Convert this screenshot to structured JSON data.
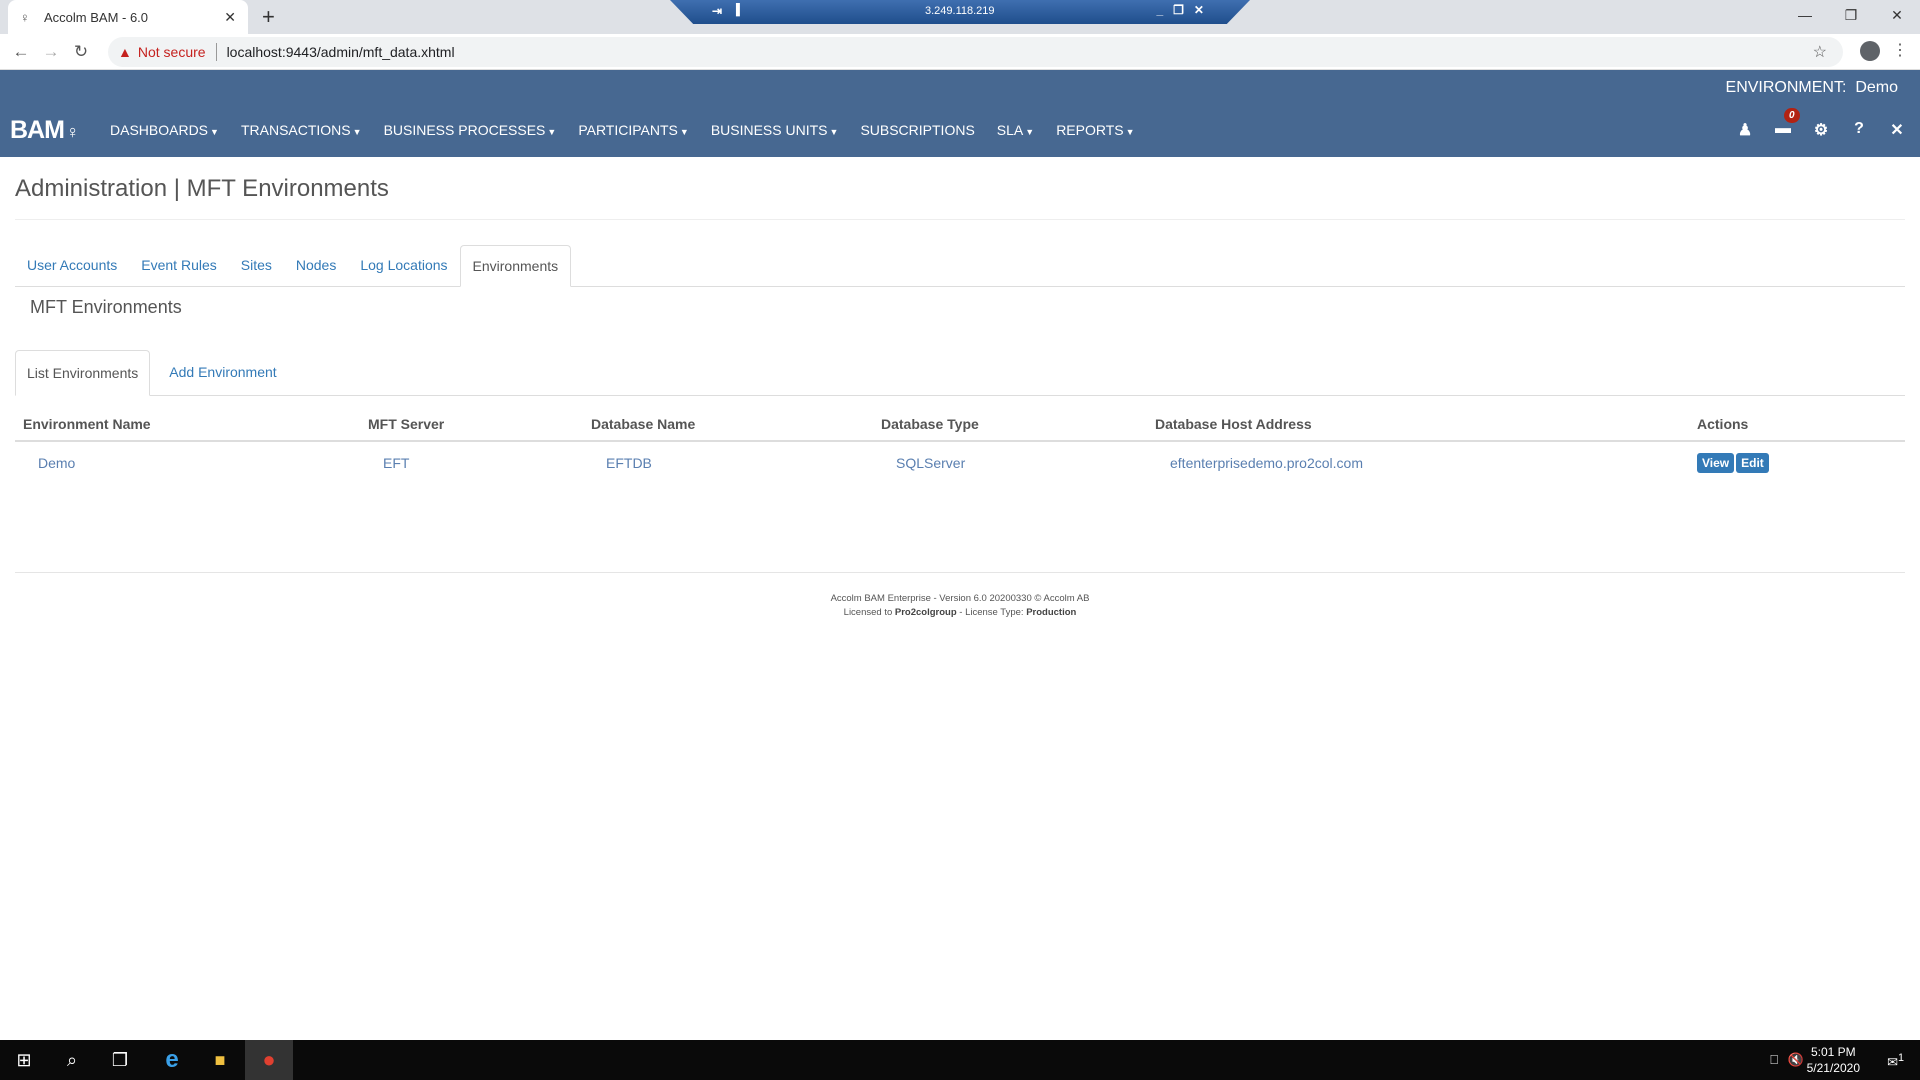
{
  "browser": {
    "tab_title": "Accolm BAM - 6.0",
    "security_label": "Not secure",
    "url": "localhost:9443/admin/mft_data.xhtml"
  },
  "rdp": {
    "host": "3.249.118.219"
  },
  "app": {
    "environment_label": "ENVIRONMENT:",
    "environment_value": "Demo",
    "logo": "BAM",
    "nav": [
      "DASHBOARDS",
      "TRANSACTIONS",
      "BUSINESS PROCESSES",
      "PARTICIPANTS",
      "BUSINESS UNITS",
      "SUBSCRIPTIONS",
      "SLA",
      "REPORTS"
    ],
    "nav_has_caret": [
      true,
      true,
      true,
      true,
      true,
      false,
      true,
      true
    ],
    "notifications_count": "0"
  },
  "page": {
    "title": "Administration | MFT Environments",
    "admin_tabs": [
      "User Accounts",
      "Event Rules",
      "Sites",
      "Nodes",
      "Log Locations",
      "Environments"
    ],
    "active_admin_tab": "Environments",
    "section_title": "MFT Environments",
    "sub_tabs": [
      "List Environments",
      "Add Environment"
    ],
    "active_sub_tab": "List Environments"
  },
  "table": {
    "headers": [
      "Environment Name",
      "MFT Server",
      "Database Name",
      "Database Type",
      "Database Host Address",
      "Actions"
    ],
    "rows": [
      {
        "name": "Demo",
        "server": "EFT",
        "db_name": "EFTDB",
        "db_type": "SQLServer",
        "host": "eftenterprisedemo.pro2col.com",
        "view": "View",
        "edit": "Edit"
      }
    ]
  },
  "footer": {
    "line1": "Accolm BAM Enterprise - Version 6.0 20200330 © Accolm AB",
    "licensed_to_label": "Licensed to",
    "licensee": "Pro2colgroup",
    "license_type_label": "- License Type:",
    "license_type": "Production"
  },
  "taskbar": {
    "time": "5:01 PM",
    "date": "5/21/2020",
    "notification_count": "1"
  }
}
